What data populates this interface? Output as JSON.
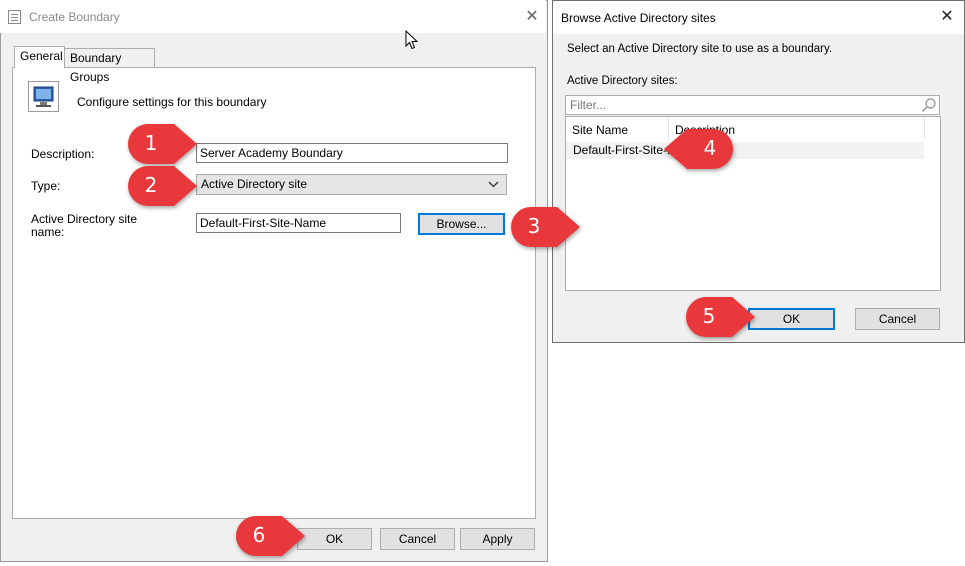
{
  "create_boundary": {
    "title": "Create Boundary",
    "close_glyph": "✕",
    "tabs": [
      {
        "label": "General",
        "active": true
      },
      {
        "label": "Boundary Groups",
        "active": false
      }
    ],
    "header_text": "Configure settings for this boundary",
    "description": {
      "label": "Description:",
      "value": "Server Academy Boundary"
    },
    "type": {
      "label": "Type:",
      "value": "Active Directory site"
    },
    "ad_site": {
      "label_line1": "Active Directory site",
      "label_line2": "name:",
      "value": "Default-First-Site-Name",
      "browse_label": "Browse..."
    },
    "buttons": {
      "ok": "OK",
      "cancel": "Cancel",
      "apply": "Apply"
    }
  },
  "browse_dialog": {
    "title": "Browse Active Directory sites",
    "close_glyph": "✕",
    "instruction": "Select an Active Directory site to use as a boundary.",
    "list_label": "Active Directory sites:",
    "filter_placeholder": "Filter...",
    "columns": [
      "Site Name",
      "Description"
    ],
    "rows": [
      {
        "site_name": "Default-First-Site-...",
        "description": ""
      }
    ],
    "buttons": {
      "ok": "OK",
      "cancel": "Cancel"
    }
  },
  "callouts": [
    "1",
    "2",
    "3",
    "4",
    "5",
    "6"
  ],
  "colors": {
    "badge": "#e8383b",
    "focus_border": "#0078d7",
    "dialog_bg": "#f0f0f0"
  }
}
